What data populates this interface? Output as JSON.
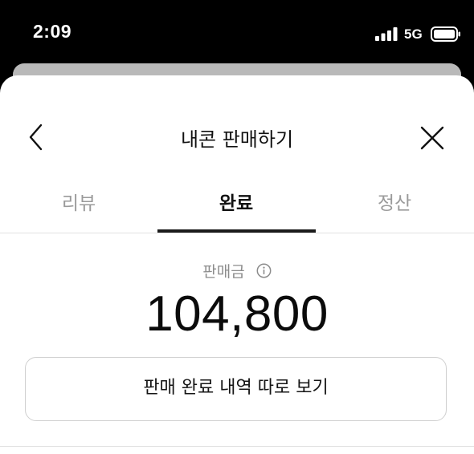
{
  "status_bar": {
    "time": "2:09",
    "network": "5G",
    "icons": [
      "signal-icon",
      "battery-icon"
    ]
  },
  "header": {
    "title": "내콘 판매하기",
    "back_icon": "chevron-left-icon",
    "close_icon": "close-icon"
  },
  "tabs": [
    {
      "label": "리뷰",
      "active": false
    },
    {
      "label": "완료",
      "active": true
    },
    {
      "label": "정산",
      "active": false
    }
  ],
  "summary": {
    "amount_label": "판매금",
    "info_icon": "info-icon",
    "amount": "104,800"
  },
  "actions": {
    "history_button_label": "판매 완료 내역 따로 보기"
  },
  "colors": {
    "background": "#000000",
    "sheet": "#ffffff",
    "active_tab": "#111111",
    "inactive_tab": "#9a9a9a",
    "muted_text": "#8c8c8c",
    "border": "#cfcfcf"
  }
}
